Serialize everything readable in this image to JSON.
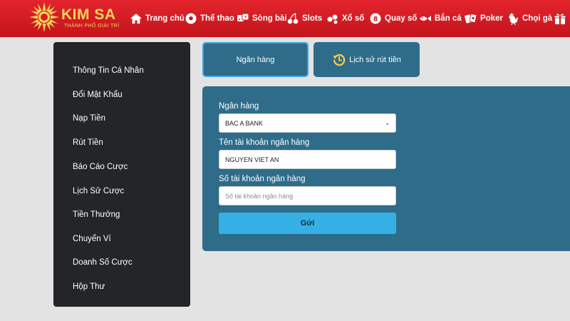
{
  "brand": {
    "name": "KIM SA",
    "tagline": "THÀNH PHỐ GIẢI TRÍ",
    "accent": "#f7d65a",
    "header_color": "#d71d25"
  },
  "nav": [
    {
      "label": "Trang chủ",
      "icon": "home-icon"
    },
    {
      "label": "Thể thao",
      "icon": "soccer-ball-icon"
    },
    {
      "label": "Sòng bài",
      "icon": "dice-icon"
    },
    {
      "label": "Slots",
      "icon": "cherry-icon"
    },
    {
      "label": "Xổ số",
      "icon": "lottery-icon"
    },
    {
      "label": "Quay số",
      "icon": "lottery-ball-icon"
    },
    {
      "label": "Bắn cá",
      "icon": "fish-icon"
    },
    {
      "label": "Poker",
      "icon": "poker-cards-icon"
    },
    {
      "label": "Chọi gà",
      "icon": "rooster-icon"
    },
    {
      "label": "",
      "icon": "gift-icon"
    }
  ],
  "sidebar": {
    "items": [
      "Thông Tin Cá Nhân",
      "Đổi Mật Khẩu",
      "Nạp Tiền",
      "Rút Tiền",
      "Báo Cáo Cược",
      "Lịch Sử Cược",
      "Tiền Thưởng",
      "Chuyển Ví",
      "Doanh Số Cược",
      "Hộp Thư"
    ]
  },
  "tabs": {
    "bank": "Ngân hàng",
    "history": "Lịch sử rút tiền"
  },
  "form": {
    "bank_label": "Ngân hàng",
    "bank_value": "BAC A BANK",
    "account_name_label": "Tên tài khoản ngân hàng",
    "account_name_value": "NGUYEN VIET AN",
    "account_number_label": "Số tài khoản ngân hàng",
    "account_number_placeholder": "Số tài khoản ngân hàng",
    "submit_label": "Gửi"
  }
}
